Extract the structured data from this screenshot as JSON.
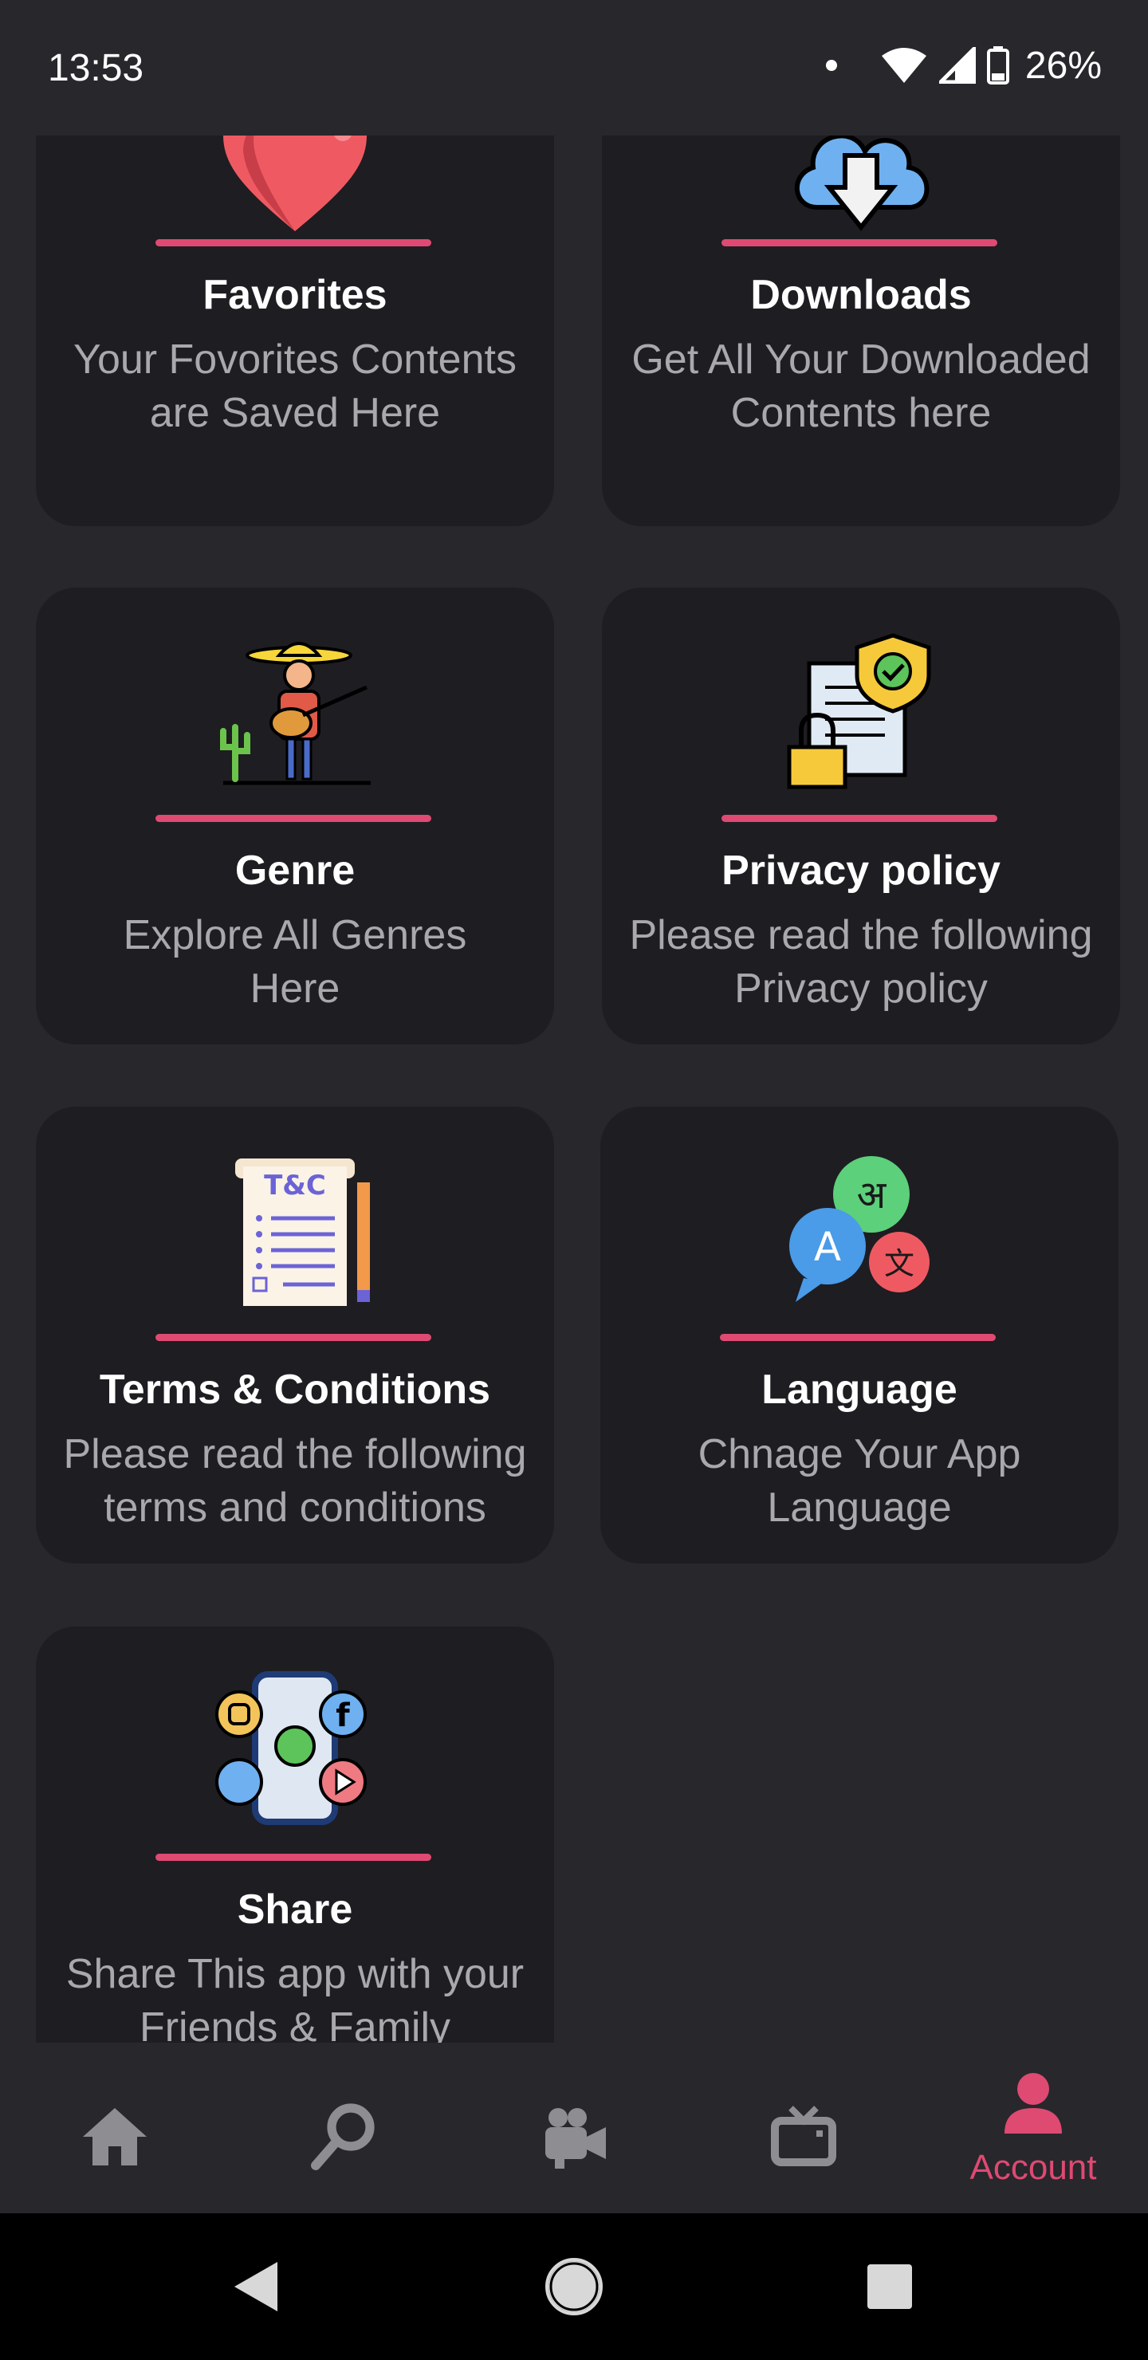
{
  "status": {
    "time": "13:53",
    "battery": "26%"
  },
  "cards": [
    {
      "id": "favorites",
      "title": "Favorites",
      "desc_line1": "Your Fovorites Contents",
      "desc_line2": "are Saved Here",
      "icon": "heart-icon"
    },
    {
      "id": "downloads",
      "title": "Downloads",
      "desc_line1": "Get All Your Downloaded",
      "desc_line2": "Contents here",
      "icon": "cloud-download-icon"
    },
    {
      "id": "genre",
      "title": "Genre",
      "desc_line1": "Explore All Genres",
      "desc_line2": "Here",
      "icon": "musician-icon"
    },
    {
      "id": "privacy",
      "title": "Privacy policy",
      "desc_line1": "Please read the following",
      "desc_line2": "Privacy policy",
      "icon": "privacy-shield-icon"
    },
    {
      "id": "terms",
      "title": "Terms & Conditions",
      "desc_line1": "Please read the following",
      "desc_line2": "terms and conditions",
      "icon": "terms-document-icon"
    },
    {
      "id": "language",
      "title": "Language",
      "desc_line1": "Chnage Your App",
      "desc_line2": "Language",
      "icon": "language-bubbles-icon"
    },
    {
      "id": "share",
      "title": "Share",
      "desc_line1": "Share This app with your",
      "desc_line2": "Friends & Family",
      "icon": "social-share-icon"
    }
  ],
  "bottom_nav": {
    "items": [
      {
        "name": "home",
        "icon": "home-icon"
      },
      {
        "name": "search",
        "icon": "search-icon"
      },
      {
        "name": "videos",
        "icon": "video-camera-icon"
      },
      {
        "name": "tv",
        "icon": "tv-icon"
      },
      {
        "name": "account",
        "icon": "account-icon",
        "label": "Account",
        "active": true
      }
    ]
  },
  "colors": {
    "accent": "#de4a72",
    "background": "#28272c",
    "card": "#1e1d22",
    "muted_text": "#a9a8ad",
    "nav_icon": "#8e8d92"
  }
}
